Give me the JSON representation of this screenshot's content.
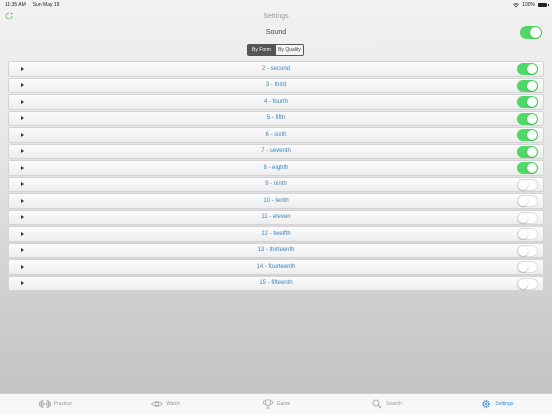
{
  "status": {
    "time": "11:35 AM",
    "date": "Sun May 19",
    "battery": "100%"
  },
  "nav": {
    "title": "Settings"
  },
  "sound": {
    "label": "Sound",
    "on": true
  },
  "segmented": {
    "options": [
      "By Form",
      "By Quality"
    ],
    "selected": 0
  },
  "intervals": [
    {
      "label": "2 - second",
      "on": true
    },
    {
      "label": "3 - third",
      "on": true
    },
    {
      "label": "4 - fourth",
      "on": true
    },
    {
      "label": "5 - fifth",
      "on": true
    },
    {
      "label": "6 - sixth",
      "on": true
    },
    {
      "label": "7 - seventh",
      "on": true
    },
    {
      "label": "8 - eighth",
      "on": true
    },
    {
      "label": "9 - ninth",
      "on": false
    },
    {
      "label": "10 - tenth",
      "on": false
    },
    {
      "label": "11 - eleven",
      "on": false
    },
    {
      "label": "12 - twelfth",
      "on": false
    },
    {
      "label": "13 - thirteenth",
      "on": false
    },
    {
      "label": "14 - fourteenth",
      "on": false
    },
    {
      "label": "15 - fifteenth",
      "on": false
    }
  ],
  "tabs": [
    {
      "label": "Practice",
      "icon": "practice-icon",
      "active": false
    },
    {
      "label": "Watch",
      "icon": "eye-icon",
      "active": false
    },
    {
      "label": "Game",
      "icon": "trophy-icon",
      "active": false
    },
    {
      "label": "Search",
      "icon": "search-icon",
      "active": false
    },
    {
      "label": "Settings",
      "icon": "gear-icon",
      "active": true
    }
  ],
  "colors": {
    "accent": "#2d8ae0",
    "toggle_on": "#4cd964",
    "row_text": "#3a86c8"
  }
}
